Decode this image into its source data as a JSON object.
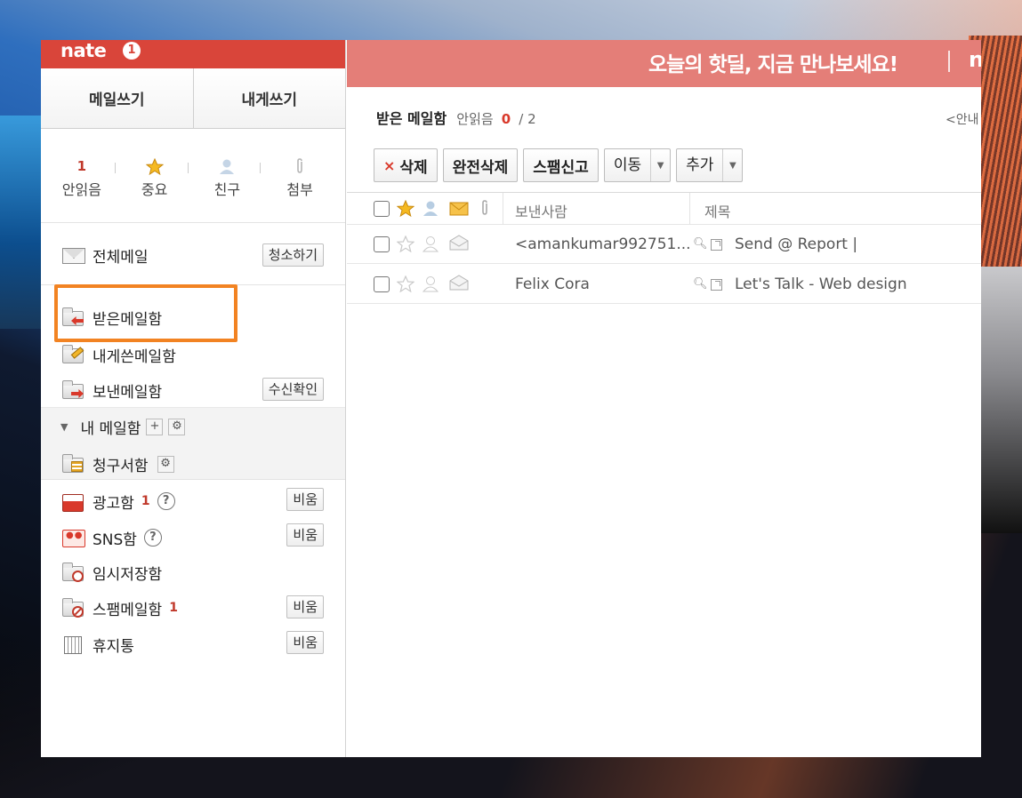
{
  "header": {
    "logo": "nate",
    "notification_count": "1"
  },
  "compose": {
    "write_mail": "메일쓰기",
    "write_to_me": "내게쓰기"
  },
  "filters": [
    {
      "top": "1",
      "label": "안읽음",
      "icon": "count"
    },
    {
      "top": "",
      "label": "중요",
      "icon": "star-icon"
    },
    {
      "top": "",
      "label": "친구",
      "icon": "person-icon"
    },
    {
      "top": "",
      "label": "첨부",
      "icon": "paperclip-icon"
    }
  ],
  "all_mail": {
    "label": "전체메일",
    "clean_button": "청소하기"
  },
  "folders": {
    "inbox": "받은메일함",
    "to_me": "내게쓴메일함",
    "sent": "보낸메일함",
    "read_receipt": "수신확인",
    "my_folders": "내 메일함",
    "plus": "+",
    "settings": "⚙",
    "billing": "청구서함",
    "ads": "광고함",
    "ads_count": "1",
    "sns": "SNS함",
    "drafts": "임시저장함",
    "spam": "스팸메일함",
    "spam_count": "1",
    "trash": "휴지통",
    "empty": "비움",
    "help": "?"
  },
  "banner": {
    "text": "오늘의 핫딜, 지금 만나보세요!",
    "tail": "n"
  },
  "inbox": {
    "title": "받은 메일함",
    "unread_label": "안읽음",
    "unread_count": "0",
    "total": "/ 2",
    "help_link": "<안내"
  },
  "toolbar": {
    "delete_x": "×",
    "delete": "삭제",
    "perm_delete": "완전삭제",
    "spam_report": "스팸신고",
    "move": "이동",
    "add": "추가",
    "dropdown_arrow": "▼"
  },
  "list": {
    "header_sender": "보낸사람",
    "header_subject": "제목",
    "rows": [
      {
        "sender": "<amankumar992751...",
        "subject": "Send @ Report |"
      },
      {
        "sender": "Felix Cora",
        "subject": "Let's Talk - Web design"
      }
    ]
  },
  "colors": {
    "nate_red": "#d9453a",
    "banner": "#e47e78",
    "highlight": "#f28322",
    "accent_red": "#d9392b"
  }
}
